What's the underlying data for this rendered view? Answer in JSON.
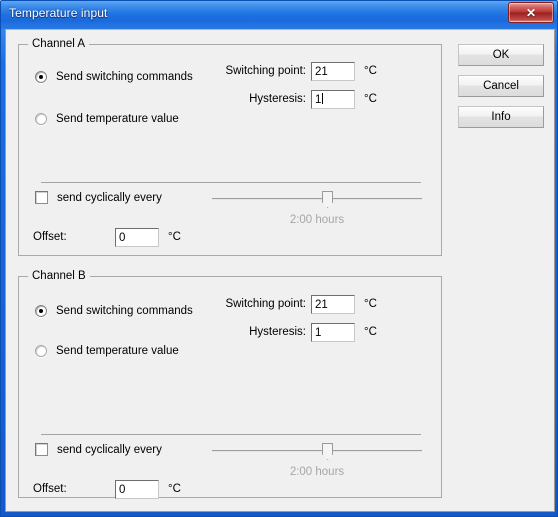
{
  "window": {
    "title": "Temperature input",
    "close_glyph": "✕"
  },
  "channel_a": {
    "legend": "Channel A",
    "radio_switching": {
      "label": "Send switching commands",
      "selected": true
    },
    "radio_temperature": {
      "label": "Send temperature value",
      "selected": false
    },
    "switching_point": {
      "label": "Switching point:",
      "value": "21",
      "unit": "°C"
    },
    "hysteresis": {
      "label": "Hysteresis:",
      "value": "1",
      "unit": "°C",
      "focused": true
    },
    "send_cyclically": {
      "label": "send cyclically every",
      "checked": false
    },
    "cycle_slider": {
      "value_label": "2:00 hours",
      "position_percent": 55
    },
    "offset": {
      "label": "Offset:",
      "value": "0",
      "unit": "°C"
    }
  },
  "channel_b": {
    "legend": "Channel B",
    "radio_switching": {
      "label": "Send switching commands",
      "selected": true
    },
    "radio_temperature": {
      "label": "Send temperature value",
      "selected": false
    },
    "switching_point": {
      "label": "Switching point:",
      "value": "21",
      "unit": "°C"
    },
    "hysteresis": {
      "label": "Hysteresis:",
      "value": "1",
      "unit": "°C",
      "focused": false
    },
    "send_cyclically": {
      "label": "send cyclically every",
      "checked": false
    },
    "cycle_slider": {
      "value_label": "2:00 hours",
      "position_percent": 55
    },
    "offset": {
      "label": "Offset:",
      "value": "0",
      "unit": "°C"
    }
  },
  "buttons": {
    "ok": "OK",
    "cancel": "Cancel",
    "info": "Info"
  },
  "colors": {
    "titlebar_blue": "#1f72e2",
    "close_red": "#b23331",
    "dialog_bg": "#f0f0f0",
    "disabled_text": "#a6a6a6"
  }
}
